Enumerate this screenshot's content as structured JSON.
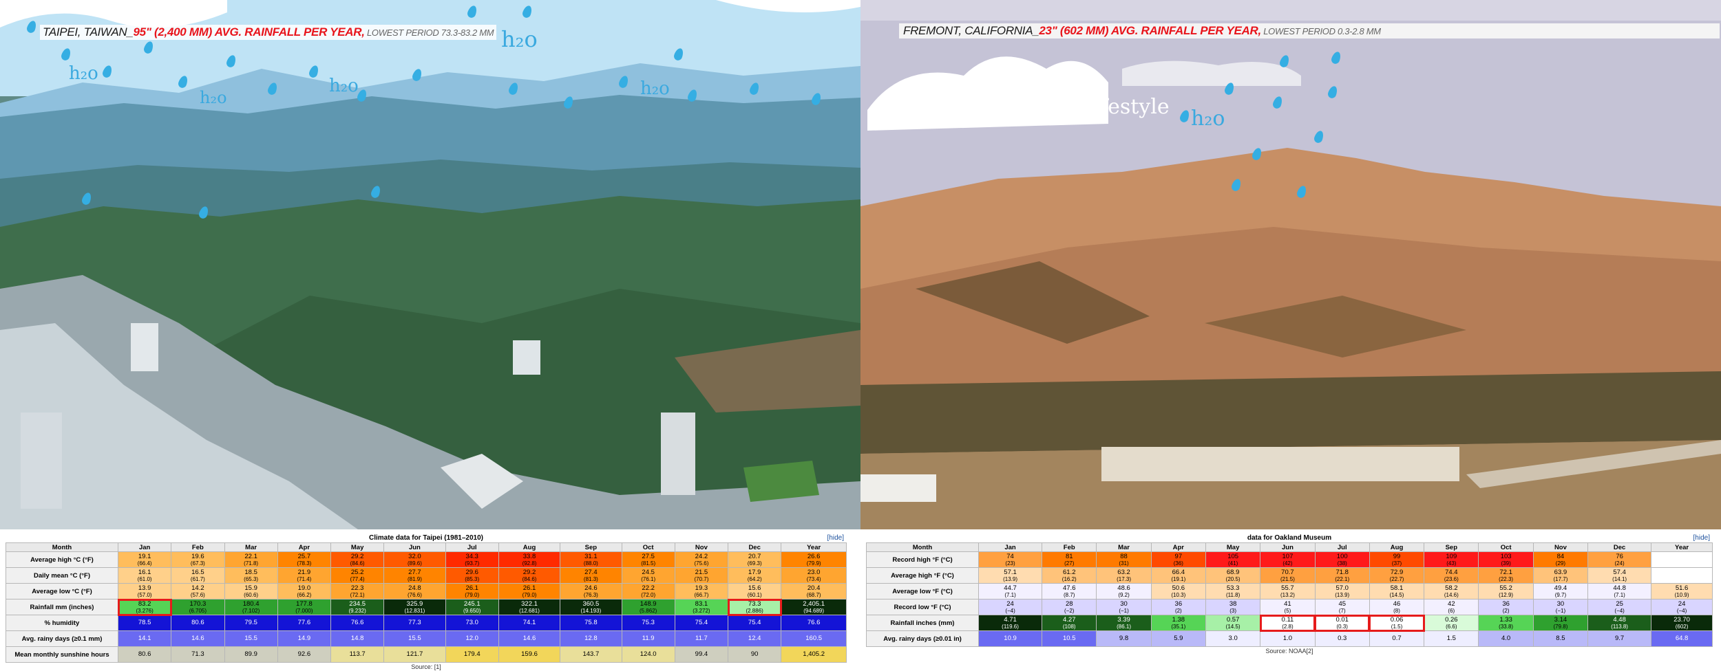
{
  "left": {
    "caption": {
      "city": "TAIPEI, TAIWAN_",
      "rain": "95\" (2,400 MM) AVG. RAINFALL PER YEAR,",
      "low": " LOWEST PERIOD 73.3-83.2 MM"
    },
    "h2o_labels": [
      "h₂o",
      "h₂o",
      "h₂o",
      "h₂o",
      "h₂o"
    ],
    "table": {
      "title": "Climate data for Taipei (1981–2010)",
      "hide_link": "[hide]",
      "columns": [
        "Month",
        "Jan",
        "Feb",
        "Mar",
        "Apr",
        "May",
        "Jun",
        "Jul",
        "Aug",
        "Sep",
        "Oct",
        "Nov",
        "Dec",
        "Year"
      ],
      "rows": [
        {
          "label": "Average high °C (°F)",
          "cells": [
            [
              "19.1",
              "(66.4)"
            ],
            [
              "19.6",
              "(67.3)"
            ],
            [
              "22.1",
              "(71.8)"
            ],
            [
              "25.7",
              "(78.3)"
            ],
            [
              "29.2",
              "(84.6)"
            ],
            [
              "32.0",
              "(89.6)"
            ],
            [
              "34.3",
              "(93.7)"
            ],
            [
              "33.8",
              "(92.8)"
            ],
            [
              "31.1",
              "(88.0)"
            ],
            [
              "27.5",
              "(81.5)"
            ],
            [
              "24.2",
              "(75.6)"
            ],
            [
              "20.7",
              "(69.3)"
            ],
            [
              "26.6",
              "(79.9)"
            ]
          ]
        },
        {
          "label": "Daily mean °C (°F)",
          "cells": [
            [
              "16.1",
              "(61.0)"
            ],
            [
              "16.5",
              "(61.7)"
            ],
            [
              "18.5",
              "(65.3)"
            ],
            [
              "21.9",
              "(71.4)"
            ],
            [
              "25.2",
              "(77.4)"
            ],
            [
              "27.7",
              "(81.9)"
            ],
            [
              "29.6",
              "(85.3)"
            ],
            [
              "29.2",
              "(84.6)"
            ],
            [
              "27.4",
              "(81.3)"
            ],
            [
              "24.5",
              "(76.1)"
            ],
            [
              "21.5",
              "(70.7)"
            ],
            [
              "17.9",
              "(64.2)"
            ],
            [
              "23.0",
              "(73.4)"
            ]
          ]
        },
        {
          "label": "Average low °C (°F)",
          "cells": [
            [
              "13.9",
              "(57.0)"
            ],
            [
              "14.2",
              "(57.6)"
            ],
            [
              "15.9",
              "(60.6)"
            ],
            [
              "19.0",
              "(66.2)"
            ],
            [
              "22.3",
              "(72.1)"
            ],
            [
              "24.8",
              "(76.6)"
            ],
            [
              "26.1",
              "(79.0)"
            ],
            [
              "26.1",
              "(79.0)"
            ],
            [
              "24.6",
              "(76.3)"
            ],
            [
              "22.2",
              "(72.0)"
            ],
            [
              "19.3",
              "(66.7)"
            ],
            [
              "15.6",
              "(60.1)"
            ],
            [
              "20.4",
              "(68.7)"
            ]
          ]
        },
        {
          "label": "Rainfall mm (inches)",
          "cells": [
            [
              "83.2",
              "(3.276)"
            ],
            [
              "170.3",
              "(6.705)"
            ],
            [
              "180.4",
              "(7.102)"
            ],
            [
              "177.8",
              "(7.000)"
            ],
            [
              "234.5",
              "(9.232)"
            ],
            [
              "325.9",
              "(12.831)"
            ],
            [
              "245.1",
              "(9.650)"
            ],
            [
              "322.1",
              "(12.681)"
            ],
            [
              "360.5",
              "(14.193)"
            ],
            [
              "148.9",
              "(5.862)"
            ],
            [
              "83.1",
              "(3.272)"
            ],
            [
              "73.3",
              "(2.886)"
            ],
            [
              "2,405.1",
              "(94.689)"
            ]
          ]
        },
        {
          "label": "% humidity",
          "cells": [
            [
              "78.5",
              ""
            ],
            [
              "80.6",
              ""
            ],
            [
              "79.5",
              ""
            ],
            [
              "77.6",
              ""
            ],
            [
              "76.6",
              ""
            ],
            [
              "77.3",
              ""
            ],
            [
              "73.0",
              ""
            ],
            [
              "74.1",
              ""
            ],
            [
              "75.8",
              ""
            ],
            [
              "75.3",
              ""
            ],
            [
              "75.4",
              ""
            ],
            [
              "75.4",
              ""
            ],
            [
              "76.6",
              ""
            ]
          ]
        },
        {
          "label": "Avg. rainy days (≥0.1 mm)",
          "cells": [
            [
              "14.1",
              ""
            ],
            [
              "14.6",
              ""
            ],
            [
              "15.5",
              ""
            ],
            [
              "14.9",
              ""
            ],
            [
              "14.8",
              ""
            ],
            [
              "15.5",
              ""
            ],
            [
              "12.0",
              ""
            ],
            [
              "14.6",
              ""
            ],
            [
              "12.8",
              ""
            ],
            [
              "11.9",
              ""
            ],
            [
              "11.7",
              ""
            ],
            [
              "12.4",
              ""
            ],
            [
              "160.5",
              ""
            ]
          ]
        },
        {
          "label": "Mean monthly sunshine hours",
          "cells": [
            [
              "80.6",
              ""
            ],
            [
              "71.3",
              ""
            ],
            [
              "89.9",
              ""
            ],
            [
              "92.6",
              ""
            ],
            [
              "113.7",
              ""
            ],
            [
              "121.7",
              ""
            ],
            [
              "179.4",
              ""
            ],
            [
              "159.6",
              ""
            ],
            [
              "143.7",
              ""
            ],
            [
              "124.0",
              ""
            ],
            [
              "99.4",
              ""
            ],
            [
              "90",
              ""
            ],
            [
              "1,405.2",
              ""
            ]
          ]
        }
      ],
      "source": "Source: [1]"
    }
  },
  "right": {
    "caption": {
      "city": "FREMONT, CALIFORNIA_",
      "rain": "23\" (602 MM) AVG. RAINFALL PER YEAR,",
      "low": " LOWEST PERIOD 0.3-2.8 MM"
    },
    "tagline": "new home...new lifestyle",
    "h2o_label": "h₂o",
    "table": {
      "title": "data for Oakland Museum",
      "hide_link": "[hide]",
      "columns": [
        "Month",
        "Jan",
        "Feb",
        "Mar",
        "Apr",
        "May",
        "Jun",
        "Jul",
        "Aug",
        "Sep",
        "Oct",
        "Nov",
        "Dec",
        "Year"
      ],
      "rows": [
        {
          "label": "Record high °F (°C)",
          "cells": [
            [
              "74",
              "(23)"
            ],
            [
              "81",
              "(27)"
            ],
            [
              "88",
              "(31)"
            ],
            [
              "97",
              "(36)"
            ],
            [
              "105",
              "(41)"
            ],
            [
              "107",
              "(42)"
            ],
            [
              "100",
              "(38)"
            ],
            [
              "99",
              "(37)"
            ],
            [
              "109",
              "(43)"
            ],
            [
              "103",
              "(39)"
            ],
            [
              "84",
              "(29)"
            ],
            [
              "76",
              "(24)"
            ],
            [
              "",
              ""
            ]
          ]
        },
        {
          "label": "Average high °F (°C)",
          "cells": [
            [
              "57.1",
              "(13.9)"
            ],
            [
              "61.2",
              "(16.2)"
            ],
            [
              "63.2",
              "(17.3)"
            ],
            [
              "66.4",
              "(19.1)"
            ],
            [
              "68.9",
              "(20.5)"
            ],
            [
              "70.7",
              "(21.5)"
            ],
            [
              "71.8",
              "(22.1)"
            ],
            [
              "72.9",
              "(22.7)"
            ],
            [
              "74.4",
              "(23.6)"
            ],
            [
              "72.1",
              "(22.3)"
            ],
            [
              "63.9",
              "(17.7)"
            ],
            [
              "57.4",
              "(14.1)"
            ],
            [
              "",
              ""
            ]
          ]
        },
        {
          "label": "Average low °F (°C)",
          "cells": [
            [
              "44.7",
              "(7.1)"
            ],
            [
              "47.6",
              "(8.7)"
            ],
            [
              "48.6",
              "(9.2)"
            ],
            [
              "50.6",
              "(10.3)"
            ],
            [
              "53.3",
              "(11.8)"
            ],
            [
              "55.7",
              "(13.2)"
            ],
            [
              "57.0",
              "(13.9)"
            ],
            [
              "58.1",
              "(14.5)"
            ],
            [
              "58.2",
              "(14.6)"
            ],
            [
              "55.2",
              "(12.9)"
            ],
            [
              "49.4",
              "(9.7)"
            ],
            [
              "44.8",
              "(7.1)"
            ],
            [
              "51.6",
              "(10.9)"
            ]
          ]
        },
        {
          "label": "Record low °F (°C)",
          "cells": [
            [
              "24",
              "(−4)"
            ],
            [
              "28",
              "(−2)"
            ],
            [
              "30",
              "(−1)"
            ],
            [
              "36",
              "(2)"
            ],
            [
              "38",
              "(3)"
            ],
            [
              "41",
              "(5)"
            ],
            [
              "45",
              "(7)"
            ],
            [
              "46",
              "(8)"
            ],
            [
              "42",
              "(6)"
            ],
            [
              "36",
              "(2)"
            ],
            [
              "30",
              "(−1)"
            ],
            [
              "25",
              "(−4)"
            ],
            [
              "24",
              "(−4)"
            ]
          ]
        },
        {
          "label": "Rainfall inches (mm)",
          "cells": [
            [
              "4.71",
              "(119.6)"
            ],
            [
              "4.27",
              "(108)"
            ],
            [
              "3.39",
              "(86.1)"
            ],
            [
              "1.38",
              "(35.1)"
            ],
            [
              "0.57",
              "(14.5)"
            ],
            [
              "0.11",
              "(2.8)"
            ],
            [
              "0.01",
              "(0.3)"
            ],
            [
              "0.06",
              "(1.5)"
            ],
            [
              "0.26",
              "(6.6)"
            ],
            [
              "1.33",
              "(33.8)"
            ],
            [
              "3.14",
              "(79.8)"
            ],
            [
              "4.48",
              "(113.8)"
            ],
            [
              "23.70",
              "(602)"
            ]
          ]
        },
        {
          "label": "Avg. rainy days (≥0.01 in)",
          "cells": [
            [
              "10.9",
              ""
            ],
            [
              "10.5",
              ""
            ],
            [
              "9.8",
              ""
            ],
            [
              "5.9",
              ""
            ],
            [
              "3.0",
              ""
            ],
            [
              "1.0",
              ""
            ],
            [
              "0.3",
              ""
            ],
            [
              "0.7",
              ""
            ],
            [
              "1.5",
              ""
            ],
            [
              "4.0",
              ""
            ],
            [
              "8.5",
              ""
            ],
            [
              "9.7",
              ""
            ],
            [
              "64.8",
              ""
            ]
          ]
        }
      ],
      "source": "Source: NOAA[2]"
    }
  },
  "colors": {
    "rain_red": "#e8141b",
    "drop_blue": "#35aee3",
    "sky_left": "#bfe3f5",
    "sky_right": "#c5c3d6"
  }
}
